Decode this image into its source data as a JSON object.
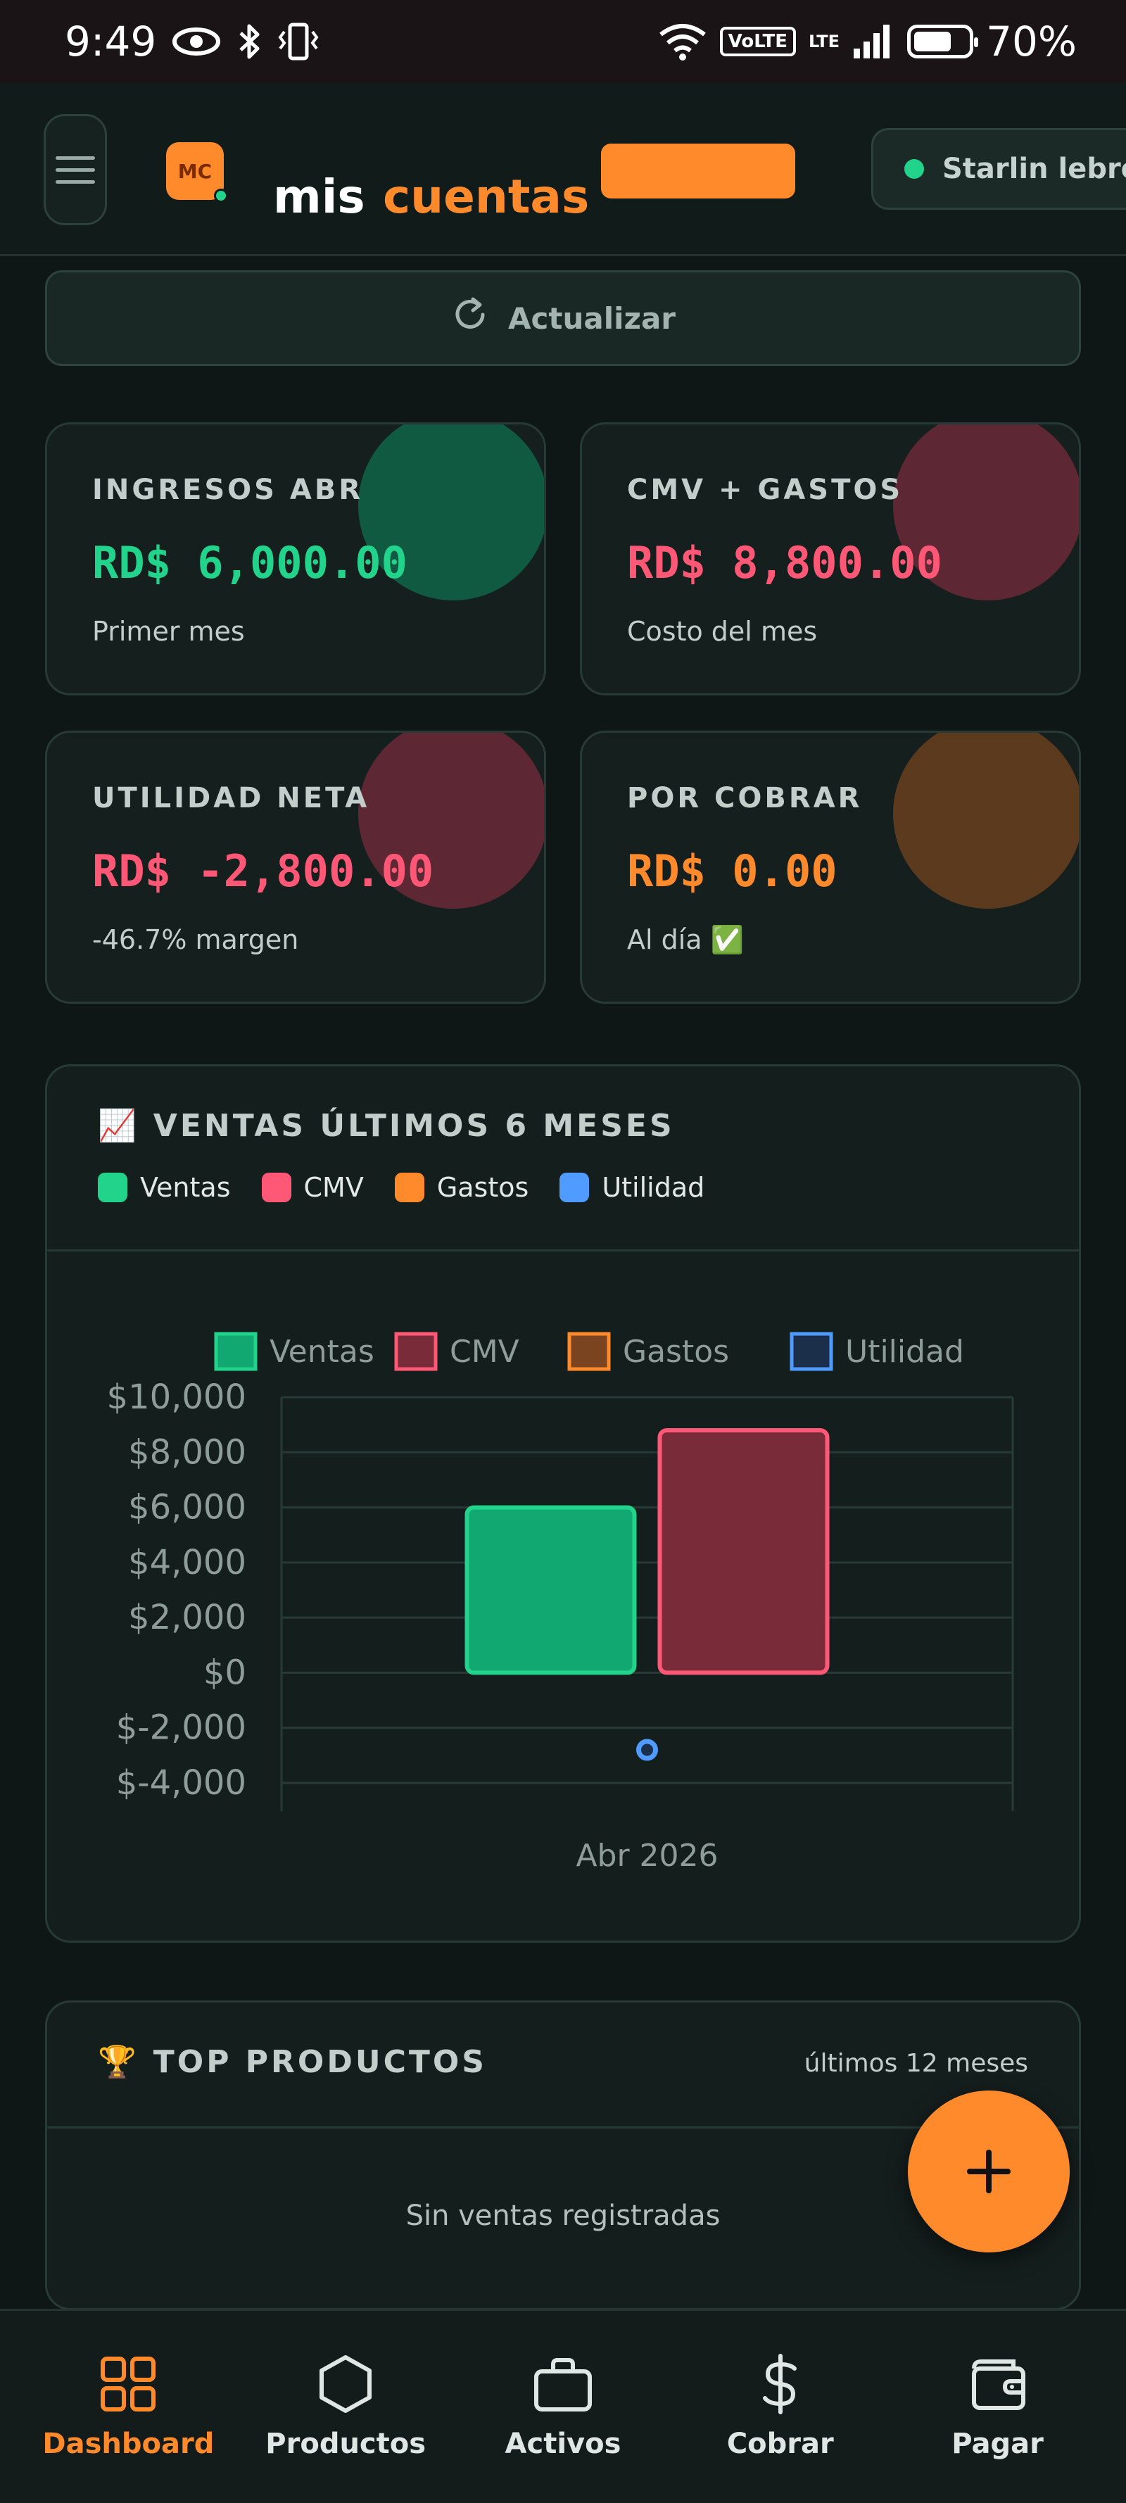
{
  "status_bar": {
    "time": "9:49",
    "volte": "VoLTE",
    "lte": "LTE",
    "battery": "70%",
    "battery_level": 0.7
  },
  "header": {
    "logo_text": "MC",
    "brand_part1": "mis",
    "brand_part2": "cuentas",
    "user_name": "Starlin lebron"
  },
  "refresh": {
    "label": "Actualizar"
  },
  "kpis": [
    {
      "label": "INGRESOS ABR",
      "value": "RD$ 6,000.00",
      "sub": "Primer mes",
      "value_color": "#22d38c",
      "blob_color": "#0f5a40"
    },
    {
      "label": "CMV + GASTOS",
      "value": "RD$ 8,800.00",
      "sub": "Costo del mes",
      "value_color": "#ff5876",
      "blob_color": "#5e2734"
    },
    {
      "label": "UTILIDAD NETA",
      "value": "RD$ -2,800.00",
      "sub": "-46.7% margen",
      "value_color": "#ff5876",
      "blob_color": "#5e2734"
    },
    {
      "label": "POR COBRAR",
      "value": "RD$ 0.00",
      "sub": "Al día ✅",
      "value_color": "#ff8a2b",
      "blob_color": "#5c3a1e"
    }
  ],
  "sales_panel": {
    "icon": "📈",
    "title": "VENTAS ÚLTIMOS 6 MESES",
    "legend": [
      {
        "label": "Ventas",
        "color": "#22d38c"
      },
      {
        "label": "CMV",
        "color": "#ff5876"
      },
      {
        "label": "Gastos",
        "color": "#ff8a2b"
      },
      {
        "label": "Utilidad",
        "color": "#4f9bff"
      }
    ]
  },
  "chart_data": {
    "type": "bar",
    "categories": [
      "Abr 2026"
    ],
    "series": [
      {
        "name": "Ventas",
        "type": "bar",
        "values": [
          6000
        ],
        "color": "#22d38c",
        "fill": "#12a872"
      },
      {
        "name": "CMV",
        "type": "bar",
        "values": [
          8800
        ],
        "color": "#ff5876",
        "fill": "#7a2b3a"
      },
      {
        "name": "Gastos",
        "type": "bar",
        "values": [
          0
        ],
        "color": "#ff8a2b",
        "fill": "#7a4420"
      },
      {
        "name": "Utilidad",
        "type": "line",
        "values": [
          -2800
        ],
        "color": "#4f9bff",
        "fill": "#1c2f4a"
      }
    ],
    "yticks": [
      "$10,000",
      "$8,000",
      "$6,000",
      "$4,000",
      "$2,000",
      "$0",
      "$-2,000",
      "$-4,000"
    ],
    "ylim": [
      -4000,
      10000
    ],
    "grid": true,
    "legend_position": "top"
  },
  "top_products": {
    "icon": "🏆",
    "title": "TOP PRODUCTOS",
    "range": "últimos 12 meses",
    "empty": "Sin ventas registradas"
  },
  "fab": {
    "icon": "plus-icon"
  },
  "nav": [
    {
      "label": "Dashboard",
      "icon": "grid-icon",
      "active": true
    },
    {
      "label": "Productos",
      "icon": "hexagon-icon",
      "active": false
    },
    {
      "label": "Activos",
      "icon": "briefcase-icon",
      "active": false
    },
    {
      "label": "Cobrar",
      "icon": "dollar-icon",
      "active": false
    },
    {
      "label": "Pagar",
      "icon": "wallet-icon",
      "active": false
    }
  ],
  "colors": {
    "accent": "#ff8a2b",
    "positive": "#22d38c",
    "negative": "#ff5876",
    "info": "#4f9bff",
    "background": "#0f1716"
  }
}
